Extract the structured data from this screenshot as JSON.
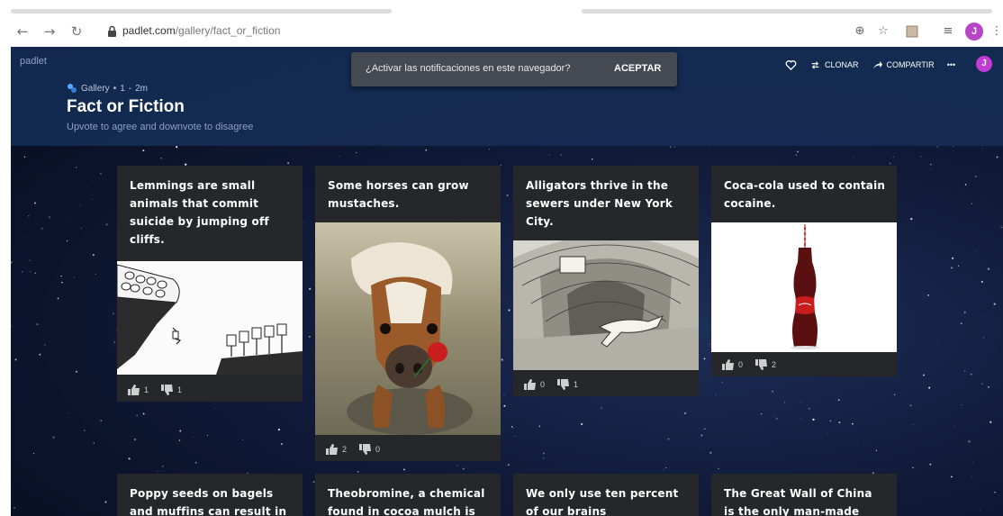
{
  "browser": {
    "url_host": "padlet.com",
    "url_path": "/gallery/fact_or_fiction",
    "profile_initial": "J"
  },
  "app": {
    "brand": "padlet",
    "meta": {
      "gallery": "Gallery",
      "dot": "•",
      "count": "1",
      "sep": "-",
      "age": "2m"
    },
    "title": "Fact or Fiction",
    "subtitle": "Upvote to agree and downvote to disagree",
    "notification": {
      "message": "¿Activar las notificaciones en este navegador?",
      "button": "ACEPTAR"
    },
    "actions": {
      "clone": "CLONAR",
      "share": "COMPARTIR",
      "more": "•••"
    },
    "avatar_initial": "J"
  },
  "cards": [
    {
      "text": "Lemmings are small animals that commit suicide by jumping off cliffs.",
      "up": "1",
      "down": "1"
    },
    {
      "text": "Some horses can grow mustaches.",
      "up": "2",
      "down": "0"
    },
    {
      "text": "Alligators thrive in the sewers under New York City.",
      "up": "0",
      "down": "1"
    },
    {
      "text": "Coca-cola used to contain cocaine.",
      "up": "0",
      "down": "2"
    },
    {
      "text": "Poppy seeds on bagels and muffins can result in"
    },
    {
      "text": "Theobromine, a chemical found in cocoa mulch is"
    },
    {
      "text": "We only use ten percent of our brains"
    },
    {
      "text": "The Great Wall of China is the only man-made object"
    }
  ],
  "colors": {
    "header_bg": "#142c54",
    "card_bg": "#26272b",
    "avatar": "#c23bd4"
  }
}
